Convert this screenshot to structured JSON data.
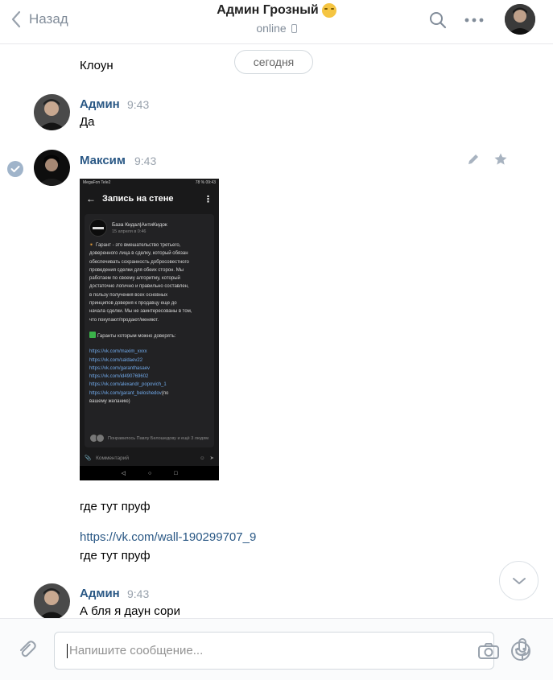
{
  "header": {
    "back_label": "Назад",
    "title": "Админ Грозный",
    "status": "online",
    "icons": [
      "chevron-left-icon",
      "search-icon",
      "more-icon",
      "emoji-icon",
      "phone-icon"
    ]
  },
  "messages": {
    "date_divider": "сегодня",
    "prev_text": "Клоун",
    "items": [
      {
        "author": "Админ",
        "time": "9:43",
        "text": "Да"
      },
      {
        "author": "Максим",
        "time": "9:43",
        "text1": "где тут пруф",
        "link": "https://vk.com/wall-190299707_9",
        "text2": "где тут пруф"
      },
      {
        "author": "Админ",
        "time": "9:43",
        "text": "А бля я даун сори"
      }
    ]
  },
  "screenshot": {
    "status_left": "MegaFon Tele2",
    "status_right": "78 % 09:43",
    "top_title": "Запись на стене",
    "post_author": "База Кидал|АнтиКидок",
    "post_date": "15 апреля в 0:46",
    "post_lines": [
      "Гарант - это вмешательство третьего,",
      "доверенного лица в сделку, который обязан",
      "обеспечивать сохранность добросовестного",
      "проведения сделки для обеих сторон. Мы",
      "работаем по своему алгоритму, который",
      "достаточно логично и правильно составлен,",
      "в пользу получения всех основных",
      "принципов доверия к продавцу еще до",
      "начала сделки. Мы не заинтересованы в том,",
      "что покупают/продают/меняют."
    ],
    "guarantors_title": "Гаранты которым можно доверять:",
    "links": [
      "https://vk.com/maxim_xxxx",
      "https://vk.com/saldaev22",
      "https://vk.com/garanthasaev",
      "https://vk.com/id490769602",
      "https://vk.com/alexandr_popovich_1",
      "https://vk.com/garant_beloshedov"
    ],
    "links_suffix": "(по",
    "links_tail": "вашему желанию)",
    "likes_text": "Понравилось Павлу Белошедову и ещё 3 людям",
    "comment_placeholder": "Комментарий"
  },
  "input": {
    "placeholder": "Напишите сообщение..."
  },
  "colors": {
    "accent": "#2a5885",
    "muted": "#818c99",
    "border": "#e7e8ec"
  }
}
